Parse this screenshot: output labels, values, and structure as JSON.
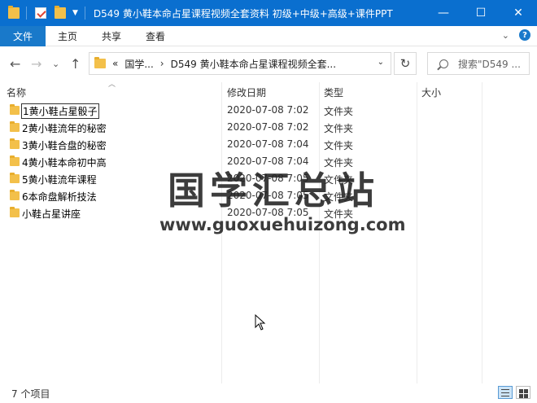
{
  "window": {
    "title": "D549 黄小鞋本命占星课程视频全套资料 初级+中级+高级+课件PPT",
    "minimize": "—",
    "maximize": "☐",
    "close": "✕"
  },
  "ribbon": {
    "tabs": [
      "文件",
      "主页",
      "共享",
      "查看"
    ],
    "expand_chevron": "⌄",
    "help": "?"
  },
  "nav": {
    "back": "←",
    "forward": "→",
    "recent": "⌄",
    "up": "↑",
    "overflow": "«",
    "breadcrumbs": [
      "国学...",
      "D549 黄小鞋本命占星课程视频全套..."
    ],
    "separator": "›",
    "dropdown": "⌄",
    "refresh": "↻",
    "search_placeholder": "搜索\"D549 ..."
  },
  "columns": {
    "name": "名称",
    "date": "修改日期",
    "type": "类型",
    "size": "大小"
  },
  "files": [
    {
      "name": "1黄小鞋占星骰子",
      "date": "2020-07-08 7:02",
      "type": "文件夹"
    },
    {
      "name": "2黄小鞋流年的秘密",
      "date": "2020-07-08 7:02",
      "type": "文件夹"
    },
    {
      "name": "3黄小鞋合盘的秘密",
      "date": "2020-07-08 7:04",
      "type": "文件夹"
    },
    {
      "name": "4黄小鞋本命初中高",
      "date": "2020-07-08 7:04",
      "type": "文件夹"
    },
    {
      "name": "5黄小鞋流年课程",
      "date": "2020-07-08 7:05",
      "type": "文件夹"
    },
    {
      "name": "6本命盘解析技法",
      "date": "2020-07-08 7:05",
      "type": "文件夹"
    },
    {
      "name": "小鞋占星讲座",
      "date": "2020-07-08 7:05",
      "type": "文件夹"
    }
  ],
  "watermark": {
    "chinese": "国学汇总站",
    "url": "www.guoxuehuizong.com"
  },
  "status": {
    "item_count": "7 个项目"
  },
  "colors": {
    "titlebar": "#0a6fcf",
    "file_tab": "#1979ca",
    "folder": "#f3c04a"
  }
}
